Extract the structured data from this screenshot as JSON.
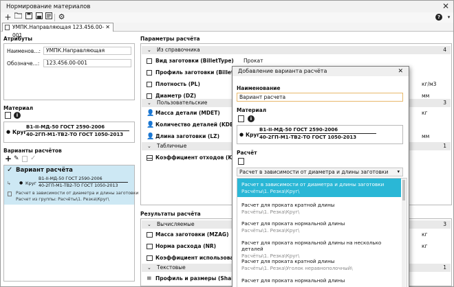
{
  "app": {
    "title": "Нормирование материалов"
  },
  "toolbar": {
    "help": "?"
  },
  "tab": {
    "label": "УМПК.Направляющая 123.456.00-001"
  },
  "attributes": {
    "section": "Атрибуты",
    "name_label": "Наименов...:",
    "name_value": "УМПК.Направляющая",
    "designation_label": "Обозначе...:",
    "designation_value": "123.456.00-001"
  },
  "material": {
    "section": "Материал",
    "shape": "Круг",
    "top": "В1-II-МД-50 ГОСТ 2590-2006",
    "bottom": "40-2ГП-М1-ТВ2-ТО ГОСТ 1050-2013"
  },
  "variants": {
    "section": "Варианты расчётов",
    "item_title": "Вариант расчёта",
    "shape": "Круг",
    "top": "В1-II-МД-50 ГОСТ 2590-2006",
    "bottom": "40-2ГП-М1-ТВ2-ТО ГОСТ 1050-2013",
    "desc1": "Расчет в зависимости от диаметра и длины заготовки",
    "desc2": "Расчет из группы: Расчёты\\1. Резка\\Круг\\"
  },
  "params": {
    "section": "Параметры расчёта",
    "groups": [
      {
        "label": "Из справочника",
        "count": "4"
      },
      {
        "label": "Пользовательские",
        "count": "3"
      },
      {
        "label": "Табличные",
        "count": "1"
      }
    ],
    "rows": [
      {
        "label": "Вид заготовки (BilletType)",
        "value": "Прокат",
        "unit": ""
      },
      {
        "label": "Профиль заготовки (BilletProf...",
        "value": "",
        "unit": ""
      },
      {
        "label": "Плотность (PL)",
        "value": "",
        "unit": "кг/м3"
      },
      {
        "label": "Диаметр (DZ)",
        "value": "",
        "unit": "мм"
      },
      {
        "label": "Масса детали (MDET)",
        "value": "",
        "unit": "кг"
      },
      {
        "label": "Количество деталей (KDET)",
        "value": "",
        "unit": ""
      },
      {
        "label": "Длина заготовки (LZ)",
        "value": "",
        "unit": "мм"
      },
      {
        "label": "Коэффициент отходов (KN)",
        "value": "",
        "unit": ""
      }
    ]
  },
  "results": {
    "section": "Результаты расчёта",
    "groups": [
      {
        "label": "Вычисляемые",
        "count": "3"
      },
      {
        "label": "Текстовые",
        "count": "1"
      }
    ],
    "rows": [
      {
        "label": "Масса заготовки (MZAG)",
        "unit": "кг"
      },
      {
        "label": "Норма расхода (NR)",
        "unit": "кг"
      },
      {
        "label": "Коэффициент использовани...",
        "unit": ""
      },
      {
        "label": "Профиль и размеры (Shablon)",
        "unit": ""
      }
    ]
  },
  "dialog": {
    "title": "Добавление варианта расчёта",
    "name_label": "Наименование",
    "name_value": "Вариант расчета",
    "material_label": "Материал",
    "shape": "Круг",
    "top": "В1-II-МД-50 ГОСТ 2590-2006",
    "bottom": "40-2ГП-М1-ТВ2-ТО ГОСТ 1050-2013",
    "calc_label": "Расчёт",
    "calc_selected": "Расчет в зависимости от диаметра и длины заготовки",
    "options": [
      {
        "title": "Расчет в зависимости от диаметра и длины заготовки",
        "path": "Расчёты\\1. Резка\\Круг\\"
      },
      {
        "title": "Расчет для проката кратной  длины",
        "path": "Расчёты\\1. Резка\\Круг\\"
      },
      {
        "title": "Расчет для проката нормальной длины",
        "path": "Расчёты\\1. Резка\\Круг\\"
      },
      {
        "title": "Расчет для проката нормальной длины на несколько деталей",
        "path": "Расчёты\\1. Резка\\Круг\\"
      },
      {
        "title": "Расчет для проката кратной длины",
        "path": "Расчёты\\1. Резка\\Уголок неравнополочный\\"
      },
      {
        "title": "Расчет для проката нормальной длины",
        "path": ""
      }
    ]
  },
  "colors": {
    "accent": "#2ab7d6",
    "selection": "#cde8f4"
  }
}
